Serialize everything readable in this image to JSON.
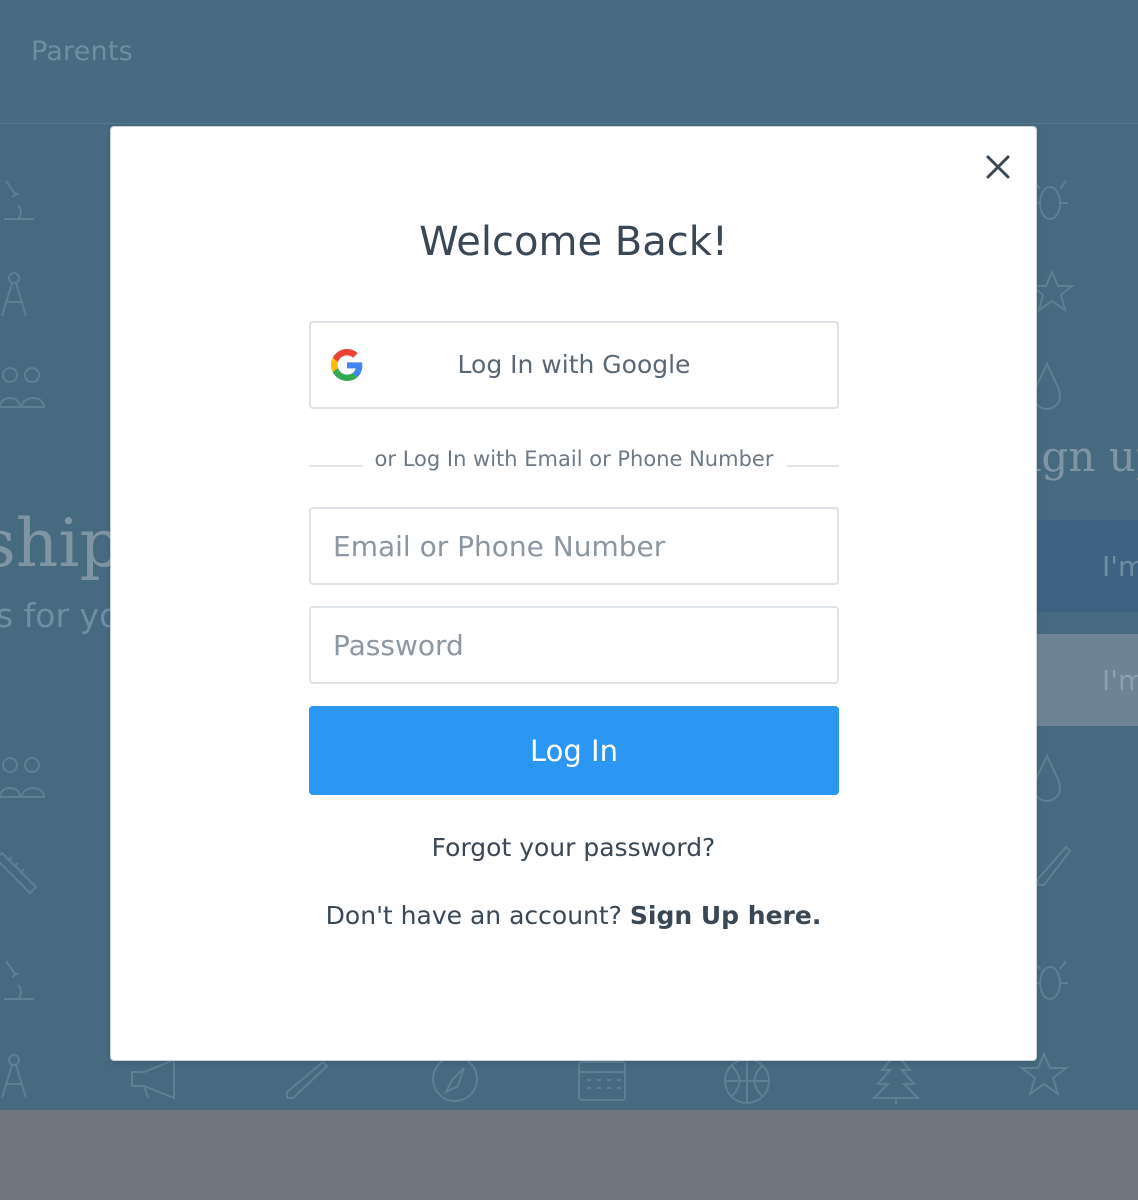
{
  "background": {
    "nav_link": "Parents",
    "hero_title": "ship",
    "hero_subtitle": "s for you",
    "signup_heading": "ign up",
    "role_primary": "I'm",
    "role_secondary": "I'm a"
  },
  "modal": {
    "title": "Welcome Back!",
    "google_button": "Log In with Google",
    "divider_text": "or Log In with Email or Phone Number",
    "email_placeholder": "Email or Phone Number",
    "password_placeholder": "Password",
    "login_button": "Log In",
    "forgot_password": "Forgot your password?",
    "no_account_text": "Don't have an account? ",
    "signup_link": "Sign Up here."
  },
  "colors": {
    "accent": "#2b97f3",
    "overlay": "#466a80",
    "text_dark": "#3a4754"
  },
  "icons": [
    "close-icon",
    "google-logo-icon"
  ]
}
